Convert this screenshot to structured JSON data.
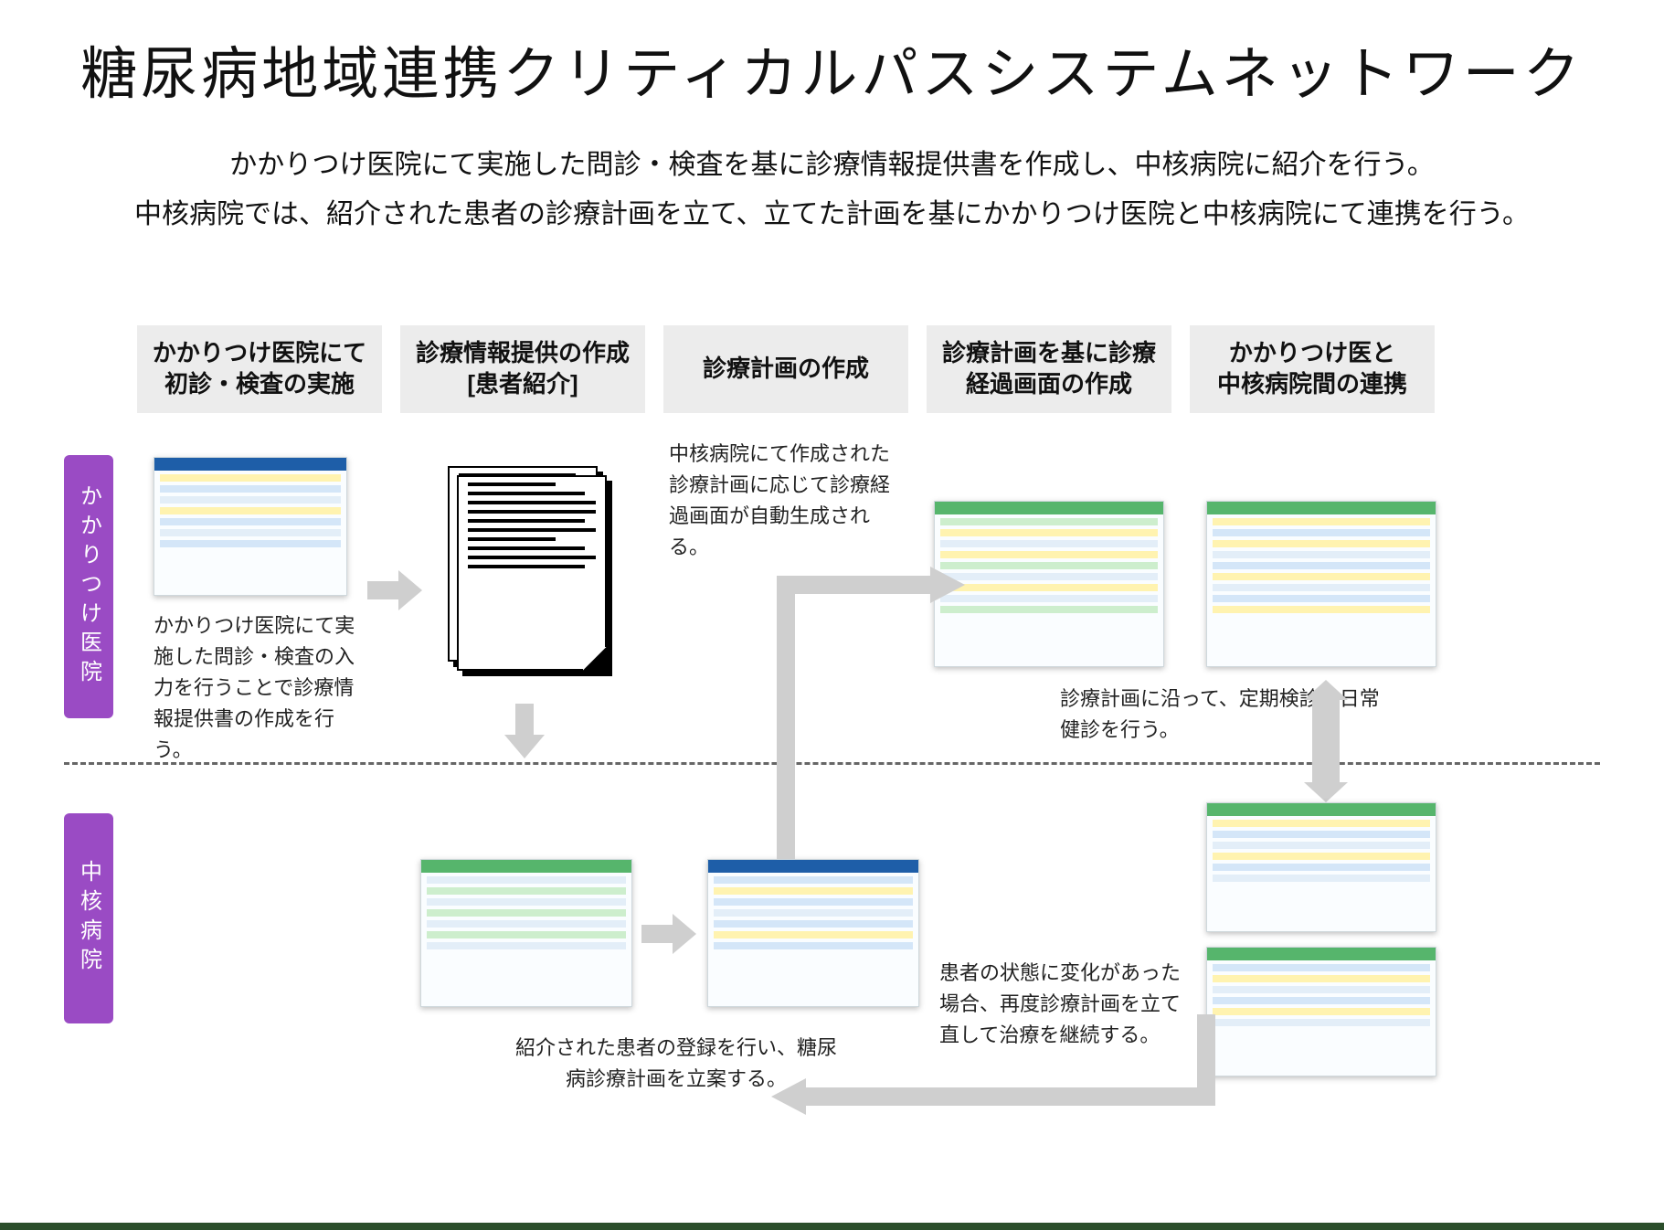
{
  "title": "糖尿病地域連携クリティカルパスシステムネットワーク",
  "subtitle_line1": "かかりつけ医院にて実施した問診・検査を基に診療情報提供書を作成し、中核病院に紹介を行う。",
  "subtitle_line2": "中核病院では、紹介された患者の診療計画を立て、立てた計画を基にかかりつけ医院と中核病院にて連携を行う。",
  "steps": {
    "s1a": "かかりつけ医院にて",
    "s1b": "初診・検査の実施",
    "s2a": "診療情報提供の作成",
    "s2b": "[患者紹介]",
    "s3": "診療計画の作成",
    "s4a": "診療計画を基に診療",
    "s4b": "経過画面の作成",
    "s5a": "かかりつけ医と",
    "s5b": "中核病院間の連携"
  },
  "rows": {
    "clinic": "かかりつけ医院",
    "core": "中核病院"
  },
  "captions": {
    "c1": "かかりつけ医院にて実施した問診・検査の入力を行うことで診療情報提供書の作成を行う。",
    "c3": "中核病院にて作成された診療計画に応じて診療経過画面が自動生成される。",
    "c5": "診療計画に沿って、定期検診、日常健診を行う。",
    "cB": "紹介された患者の登録を行い、糖尿病診療計画を立案する。",
    "c4b": "患者の状態に変化があった場合、再度診療計画を立て直して治療を継続する。"
  }
}
